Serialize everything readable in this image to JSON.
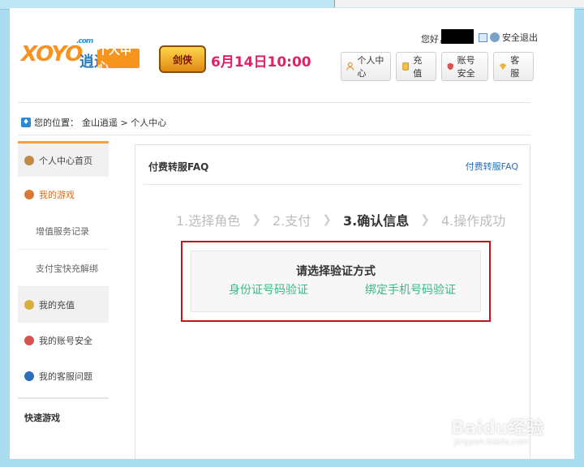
{
  "header": {
    "logo_text_1": "XOYO",
    "logo_dotcom": ".com",
    "logo_cn": "逍遥",
    "center_badge": "个人中心",
    "game_banner": "剑侠",
    "date_text": "6月14日10:00",
    "greet": "您好，",
    "logout": "安全退出",
    "nav": [
      {
        "label": "个人中心",
        "icon": "person-icon"
      },
      {
        "label": "充 值",
        "icon": "recharge-icon"
      },
      {
        "label": "账号安全",
        "icon": "shield-icon"
      },
      {
        "label": "客 服",
        "icon": "service-icon"
      }
    ]
  },
  "breadcrumb": {
    "prefix": "您的位置：",
    "path": "金山逍遥 > 个人中心"
  },
  "sidebar": {
    "items": [
      {
        "label": "个人中心首页"
      },
      {
        "label": "我的游戏"
      },
      {
        "label": "增值服务记录"
      },
      {
        "label": "支付宝快充解绑"
      },
      {
        "label": "我的充值"
      },
      {
        "label": "我的账号安全"
      },
      {
        "label": "我的客服问题"
      },
      {
        "label": "快速游戏"
      }
    ]
  },
  "main": {
    "title": "付费转服FAQ",
    "link": "付费转服FAQ",
    "steps": [
      "1.选择角色",
      "2.支付",
      "3.确认信息",
      "4.操作成功"
    ],
    "verify_title": "请选择验证方式",
    "option_id": "身份证号码验证",
    "option_phone": "绑定手机号码验证"
  },
  "watermark": {
    "text": "Baidu经验",
    "sub": "jingyan.baidu.com"
  },
  "colors": {
    "accent_orange": "#f7941d",
    "verify_border": "#c0141b",
    "option_green": "#3bb884",
    "date_pink": "#e2206a"
  }
}
